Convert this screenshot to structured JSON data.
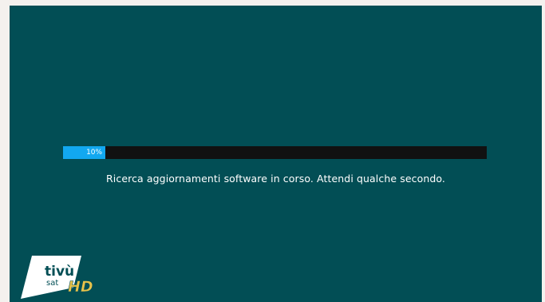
{
  "progress": {
    "percent": 10,
    "label": "10%"
  },
  "status": {
    "message": "Ricerca aggiornamenti software in corso. Attendi qualche secondo."
  },
  "logo": {
    "brand": "tivù",
    "sub": "sat",
    "badge": "HD"
  },
  "colors": {
    "background": "#024e55",
    "progress_fill": "#12a8f0",
    "progress_track": "#111111",
    "logo_badge": "#e8c24a"
  }
}
